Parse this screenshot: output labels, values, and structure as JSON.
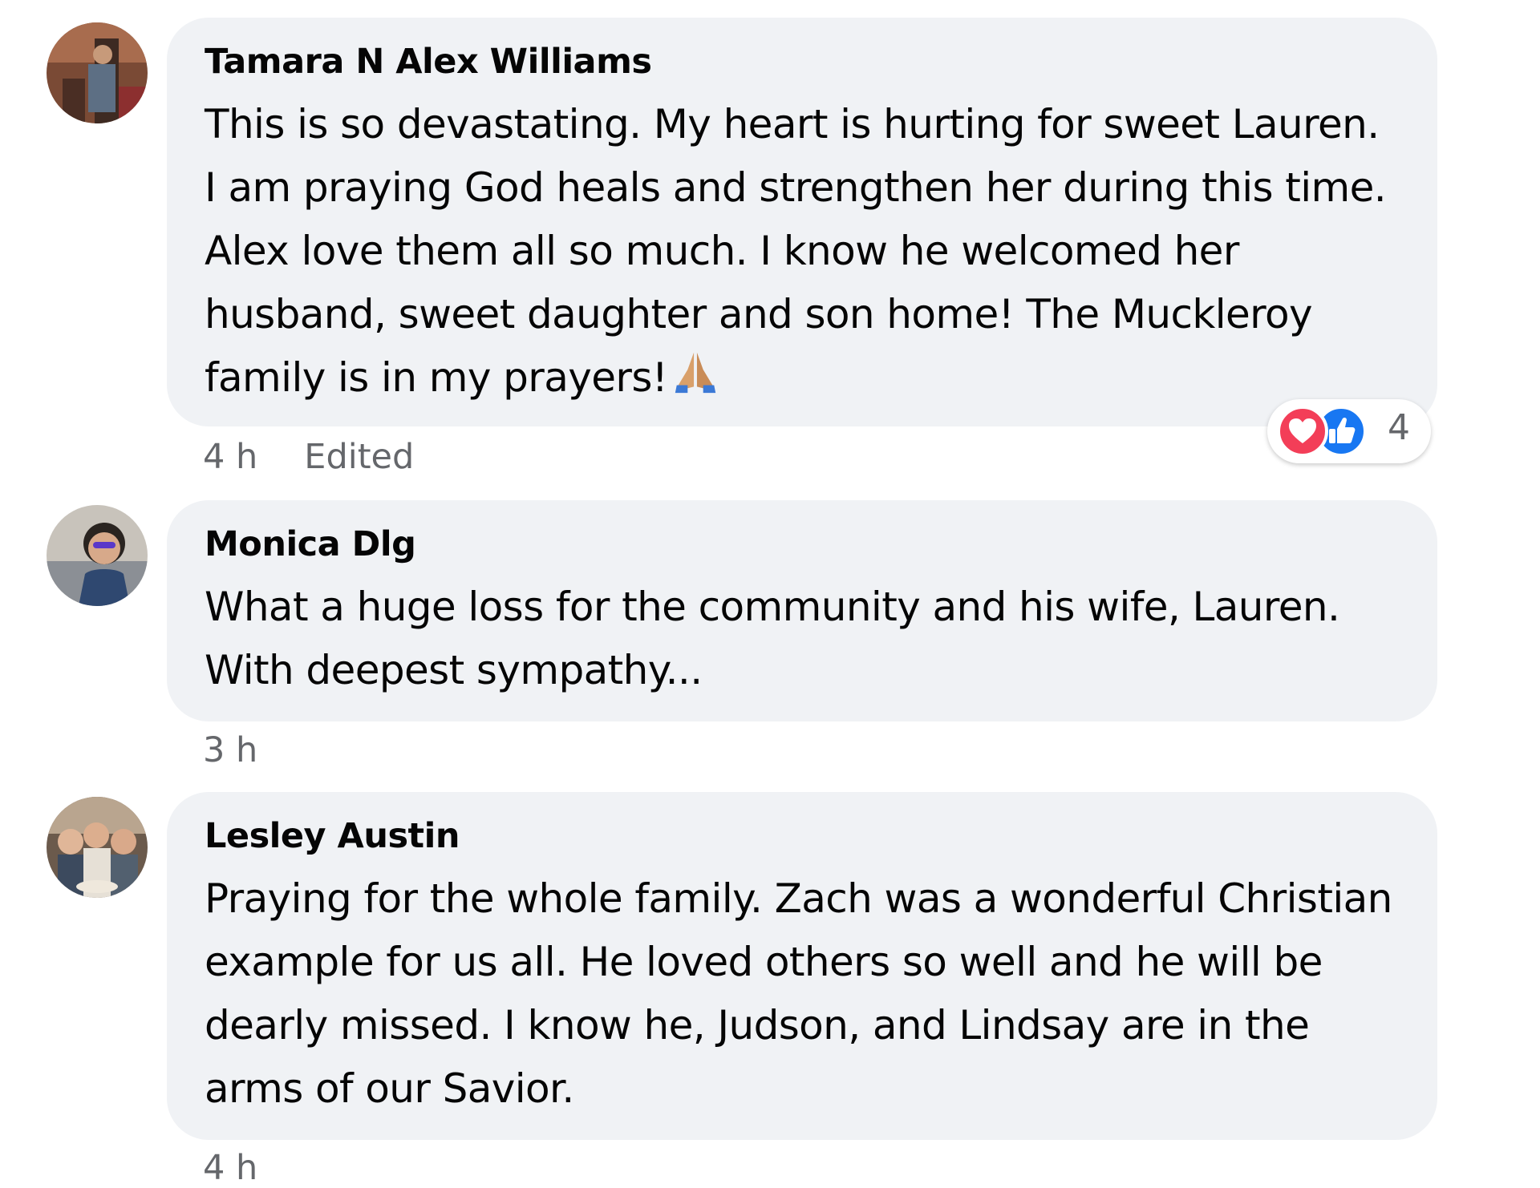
{
  "comments": [
    {
      "author": "Tamara N Alex Williams",
      "text": "This is so devastating. My heart is hurting for sweet Lauren. I am praying God heals and strengthen her during this time. Alex love them all so much. I know he welcomed her husband, sweet daughter and son home! The Muckleroy family is in my prayers!",
      "emoji": "folded-hands",
      "time": "4 h",
      "edited": "Edited",
      "reaction_count": "4",
      "reaction_icons": [
        "love-icon",
        "like-icon"
      ]
    },
    {
      "author": "Monica Dlg",
      "text": "What a huge loss for the community and his wife, Lauren. With deepest sympathy...",
      "time": "3 h"
    },
    {
      "author": "Lesley Austin",
      "text": "Praying for the whole family. Zach was a wonderful Christian example for us all. He loved others so well and he will be dearly missed. I know he, Judson, and Lindsay are in the arms of our Savior.",
      "time": "4 h"
    }
  ],
  "colors": {
    "bubble": "#f0f2f5",
    "meta_text": "#65676b",
    "love": "#f33e58",
    "like": "#1877f2"
  }
}
